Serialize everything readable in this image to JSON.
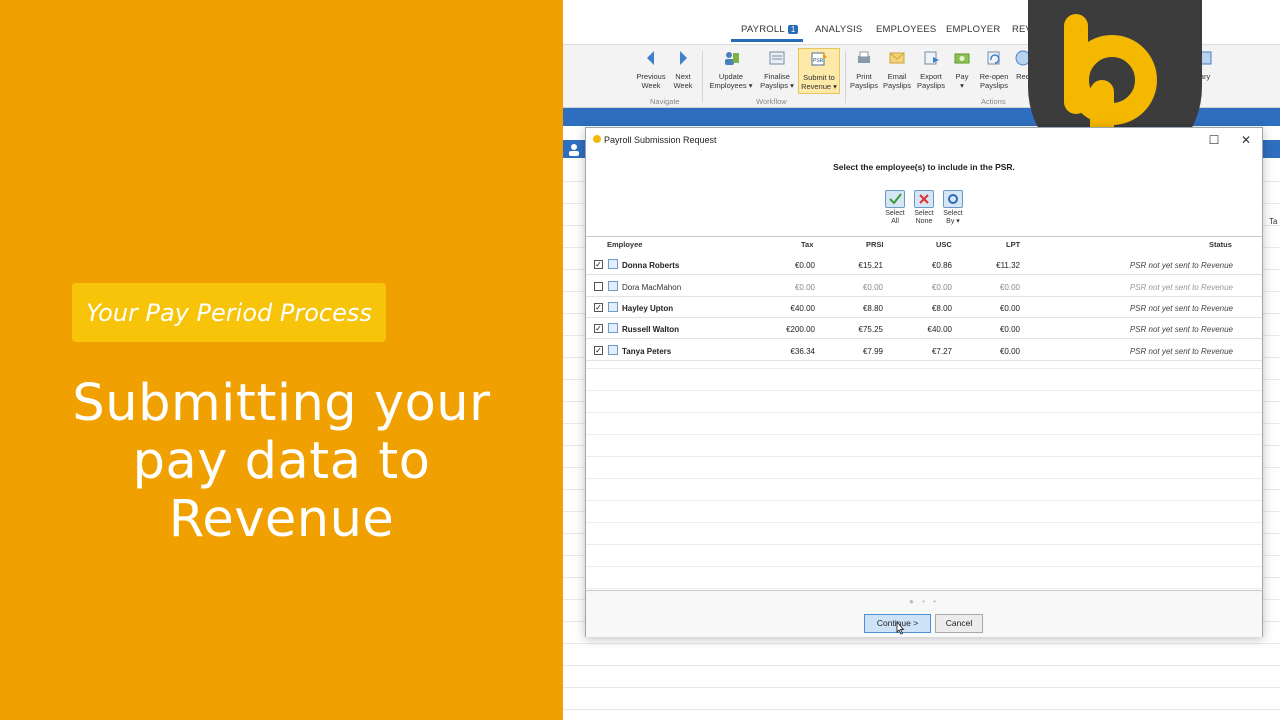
{
  "promo": {
    "pill": "Your Pay Period Process",
    "headline": [
      "Submitting your",
      "pay data to",
      "Revenue"
    ]
  },
  "menu": {
    "items": [
      "PAYROLL",
      "ANALYSIS",
      "EMPLOYEES",
      "EMPLOYER",
      "REV"
    ],
    "payroll_badge": "1"
  },
  "ribbon": {
    "buttons": [
      {
        "label1": "Previous",
        "label2": "Week"
      },
      {
        "label1": "Next",
        "label2": "Week"
      },
      {
        "label1": "Update",
        "label2": "Employees ▾"
      },
      {
        "label1": "Finalise",
        "label2": "Payslips ▾"
      },
      {
        "label1": "Submit to",
        "label2": "Revenue ▾"
      },
      {
        "label1": "Print",
        "label2": "Payslips"
      },
      {
        "label1": "Email",
        "label2": "Payslips"
      },
      {
        "label1": "Export",
        "label2": "Payslips"
      },
      {
        "label1": "Pay",
        "label2": "▾"
      },
      {
        "label1": "Re-open",
        "label2": "Payslips"
      },
      {
        "label1": "Req",
        "label2": ""
      },
      {
        "label1": "ary",
        "label2": ""
      }
    ],
    "groups": [
      "Navigate",
      "Workflow",
      "Actions"
    ]
  },
  "dialog": {
    "title": "Payroll Submission Request",
    "prompt": "Select the employee(s) to include in the PSR.",
    "select_buttons": [
      {
        "label1": "Select",
        "label2": "All"
      },
      {
        "label1": "Select",
        "label2": "None"
      },
      {
        "label1": "Select",
        "label2": "By ▾"
      }
    ],
    "columns": [
      "Employee",
      "Tax",
      "PRSI",
      "USC",
      "LPT",
      "Status"
    ],
    "rows": [
      {
        "checked": true,
        "name": "Donna Roberts",
        "tax": "€0.00",
        "prsi": "€15.21",
        "usc": "€0.86",
        "lpt": "€11.32",
        "status": "PSR not yet sent to Revenue"
      },
      {
        "checked": false,
        "name": "Dora MacMahon",
        "tax": "€0.00",
        "prsi": "€0.00",
        "usc": "€0.00",
        "lpt": "€0.00",
        "status": "PSR not yet sent to Revenue"
      },
      {
        "checked": true,
        "name": "Hayley Upton",
        "tax": "€40.00",
        "prsi": "€8.80",
        "usc": "€8.00",
        "lpt": "€0.00",
        "status": "PSR not yet sent to Revenue"
      },
      {
        "checked": true,
        "name": "Russell Walton",
        "tax": "€200.00",
        "prsi": "€75.25",
        "usc": "€40.00",
        "lpt": "€0.00",
        "status": "PSR not yet sent to Revenue"
      },
      {
        "checked": true,
        "name": "Tanya Peters",
        "tax": "€36.34",
        "prsi": "€7.99",
        "usc": "€7.27",
        "lpt": "€0.00",
        "status": "PSR not yet sent to Revenue"
      }
    ],
    "continue_label": "Continue >",
    "cancel_label": "Cancel",
    "step_dots": "● • •"
  },
  "misc": {
    "ta_header": "Ta"
  },
  "colors": {
    "orange": "#f0a000",
    "pill": "#f7c40a",
    "brand_blue": "#2f6fc0",
    "logo_bg": "#3c3c3c",
    "logo_yellow": "#f5b800"
  }
}
